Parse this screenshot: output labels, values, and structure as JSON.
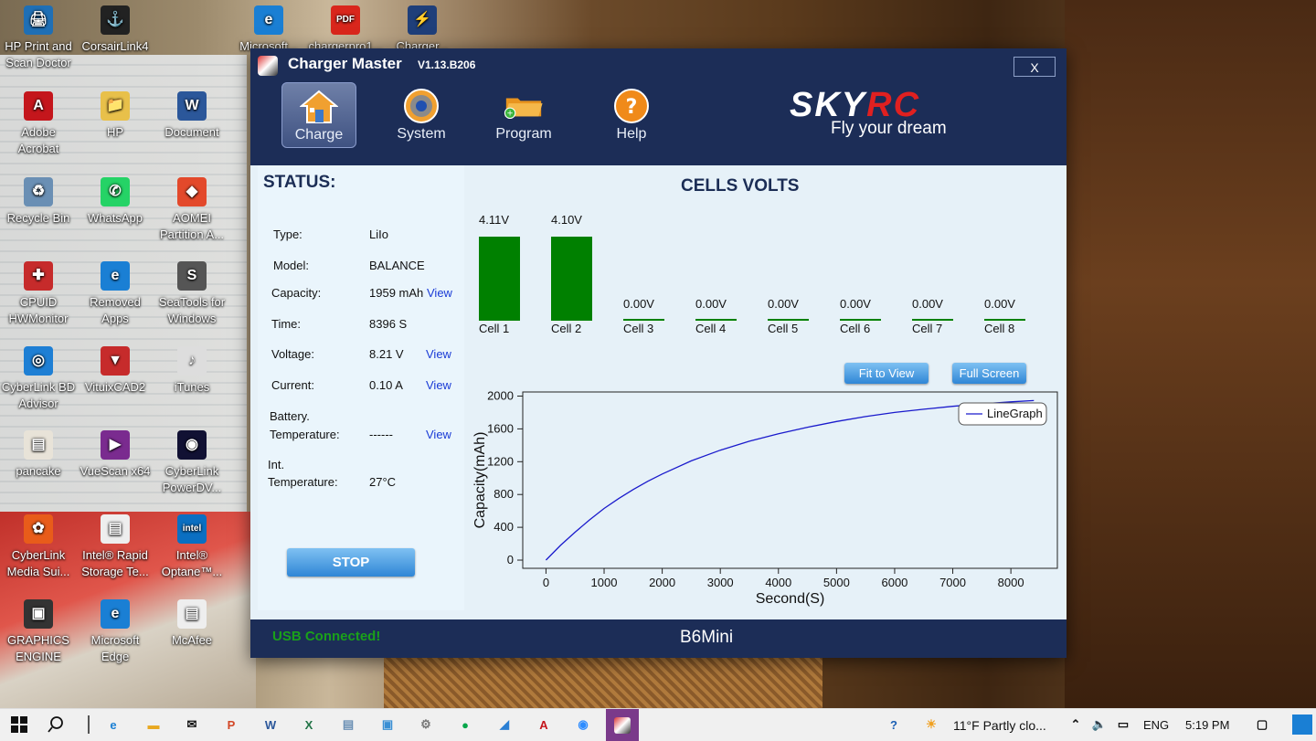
{
  "desktop": {
    "icons": [
      {
        "label": "HP Print and Scan Doctor",
        "color": "#1f6fb5",
        "glyph": "🖨"
      },
      {
        "label": "CorsairLink4",
        "color": "#222222",
        "glyph": "⚓"
      },
      {
        "label": "Microsoft...",
        "color": "#1a7fd4",
        "glyph": "e"
      },
      {
        "label": "chargerpro1...",
        "color": "#d9261c",
        "glyph": "PDF"
      },
      {
        "label": "Charger...",
        "color": "#1f3f7a",
        "glyph": "⚡"
      },
      {
        "label": "Adobe Acrobat",
        "color": "#c4161c",
        "glyph": "A"
      },
      {
        "label": "HP",
        "color": "#e8c04a",
        "glyph": "📁"
      },
      {
        "label": "Document",
        "color": "#2b579a",
        "glyph": "W"
      },
      {
        "label": "Recycle Bin",
        "color": "#6a8fb4",
        "glyph": "♻"
      },
      {
        "label": "WhatsApp",
        "color": "#25d366",
        "glyph": "✆"
      },
      {
        "label": "AOMEI Partition A...",
        "color": "#e3492b",
        "glyph": "◆"
      },
      {
        "label": "CPUID HWMonitor",
        "color": "#c62b2b",
        "glyph": "✚"
      },
      {
        "label": "Removed Apps",
        "color": "#1a7fd4",
        "glyph": "e"
      },
      {
        "label": "SeaTools for Windows",
        "color": "#555555",
        "glyph": "S"
      },
      {
        "label": "CyberLink BD Advisor",
        "color": "#1e7fd4",
        "glyph": "◎"
      },
      {
        "label": "VituixCAD2",
        "color": "#c62b2b",
        "glyph": "▼"
      },
      {
        "label": "iTunes",
        "color": "#dddddd",
        "glyph": "♪"
      },
      {
        "label": "pancake",
        "color": "#e8e3d8",
        "glyph": "▤"
      },
      {
        "label": "VueScan x64",
        "color": "#7a2b8f",
        "glyph": "▶"
      },
      {
        "label": "CyberLink PowerDV...",
        "color": "#111133",
        "glyph": "◉"
      },
      {
        "label": "CyberLink Media Sui...",
        "color": "#e85c1a",
        "glyph": "✿"
      },
      {
        "label": "Intel® Rapid Storage Te...",
        "color": "#eeeeee",
        "glyph": "▤"
      },
      {
        "label": "Intel® Optane™...",
        "color": "#0a6fc2",
        "glyph": "intel"
      },
      {
        "label": "GRAPHICS ENGINE",
        "color": "#333333",
        "glyph": "▣"
      },
      {
        "label": "Microsoft Edge",
        "color": "#1a7fd4",
        "glyph": "e"
      },
      {
        "label": "McAfee",
        "color": "#eeeeee",
        "glyph": "▤"
      }
    ]
  },
  "window": {
    "title": "Charger Master",
    "version": "V1.13.B206",
    "close_label": "X",
    "toolbar": [
      {
        "label": "Charge",
        "icon": "house-icon"
      },
      {
        "label": "System",
        "icon": "gear-icon"
      },
      {
        "label": "Program",
        "icon": "folder-icon"
      },
      {
        "label": "Help",
        "icon": "help-icon"
      }
    ],
    "brand": {
      "logo_a": "SKY",
      "logo_b": "RC",
      "tagline": "Fly your dream"
    }
  },
  "status": {
    "title": "STATUS:",
    "type_label": "Type:",
    "type_value": "LiIo",
    "model_label": "Model:",
    "model_value": "BALANCE",
    "capacity_label": "Capacity:",
    "capacity_value": "1959 mAh",
    "time_label": "Time:",
    "time_value": "8396 S",
    "voltage_label": "Voltage:",
    "voltage_value": "8.21 V",
    "current_label": "Current:",
    "current_value": "0.10 A",
    "battery_temp_label_1": "Battery.",
    "battery_temp_label_2": "Temperature:",
    "battery_temp_value": "------",
    "int_temp_label_1": "Int.",
    "int_temp_label_2": "Temperature:",
    "int_temp_value": "27°C",
    "view_label": "View",
    "stop_label": "STOP"
  },
  "cells": {
    "title": "CELLS VOLTS",
    "items": [
      {
        "name": "Cell 1",
        "volts": "4.11V",
        "value": 4.11
      },
      {
        "name": "Cell 2",
        "volts": "4.10V",
        "value": 4.1
      },
      {
        "name": "Cell 3",
        "volts": "0.00V",
        "value": 0
      },
      {
        "name": "Cell 4",
        "volts": "0.00V",
        "value": 0
      },
      {
        "name": "Cell 5",
        "volts": "0.00V",
        "value": 0
      },
      {
        "name": "Cell 6",
        "volts": "0.00V",
        "value": 0
      },
      {
        "name": "Cell 7",
        "volts": "0.00V",
        "value": 0
      },
      {
        "name": "Cell 8",
        "volts": "0.00V",
        "value": 0
      }
    ]
  },
  "graph_buttons": {
    "fit": "Fit to View",
    "full": "Full Screen"
  },
  "chart_data": {
    "type": "line",
    "xlabel": "Second(S)",
    "ylabel": "Capacity(mAh)",
    "xlim": [
      -400,
      8800
    ],
    "ylim": [
      -100,
      2050
    ],
    "xticks": [
      0,
      1000,
      2000,
      3000,
      4000,
      5000,
      6000,
      7000,
      8000
    ],
    "yticks": [
      0,
      400,
      800,
      1200,
      1600,
      2000
    ],
    "legend": "top-right",
    "series": [
      {
        "name": "LineGraph",
        "color": "#1a1acc",
        "x": [
          0,
          250,
          500,
          750,
          1000,
          1250,
          1500,
          1750,
          2000,
          2500,
          3000,
          3500,
          4000,
          4500,
          5000,
          5500,
          6000,
          6500,
          7000,
          7500,
          8000,
          8396
        ],
        "y": [
          0,
          180,
          340,
          490,
          630,
          750,
          860,
          960,
          1050,
          1210,
          1340,
          1450,
          1540,
          1620,
          1690,
          1750,
          1800,
          1840,
          1875,
          1905,
          1930,
          1945
        ]
      }
    ]
  },
  "statusbar": {
    "usb": "USB  Connected!",
    "device": "B6Mini"
  },
  "taskbar": {
    "weather": "11°F  Partly clo...",
    "lang": "ENG",
    "time": "5:19 PM"
  }
}
